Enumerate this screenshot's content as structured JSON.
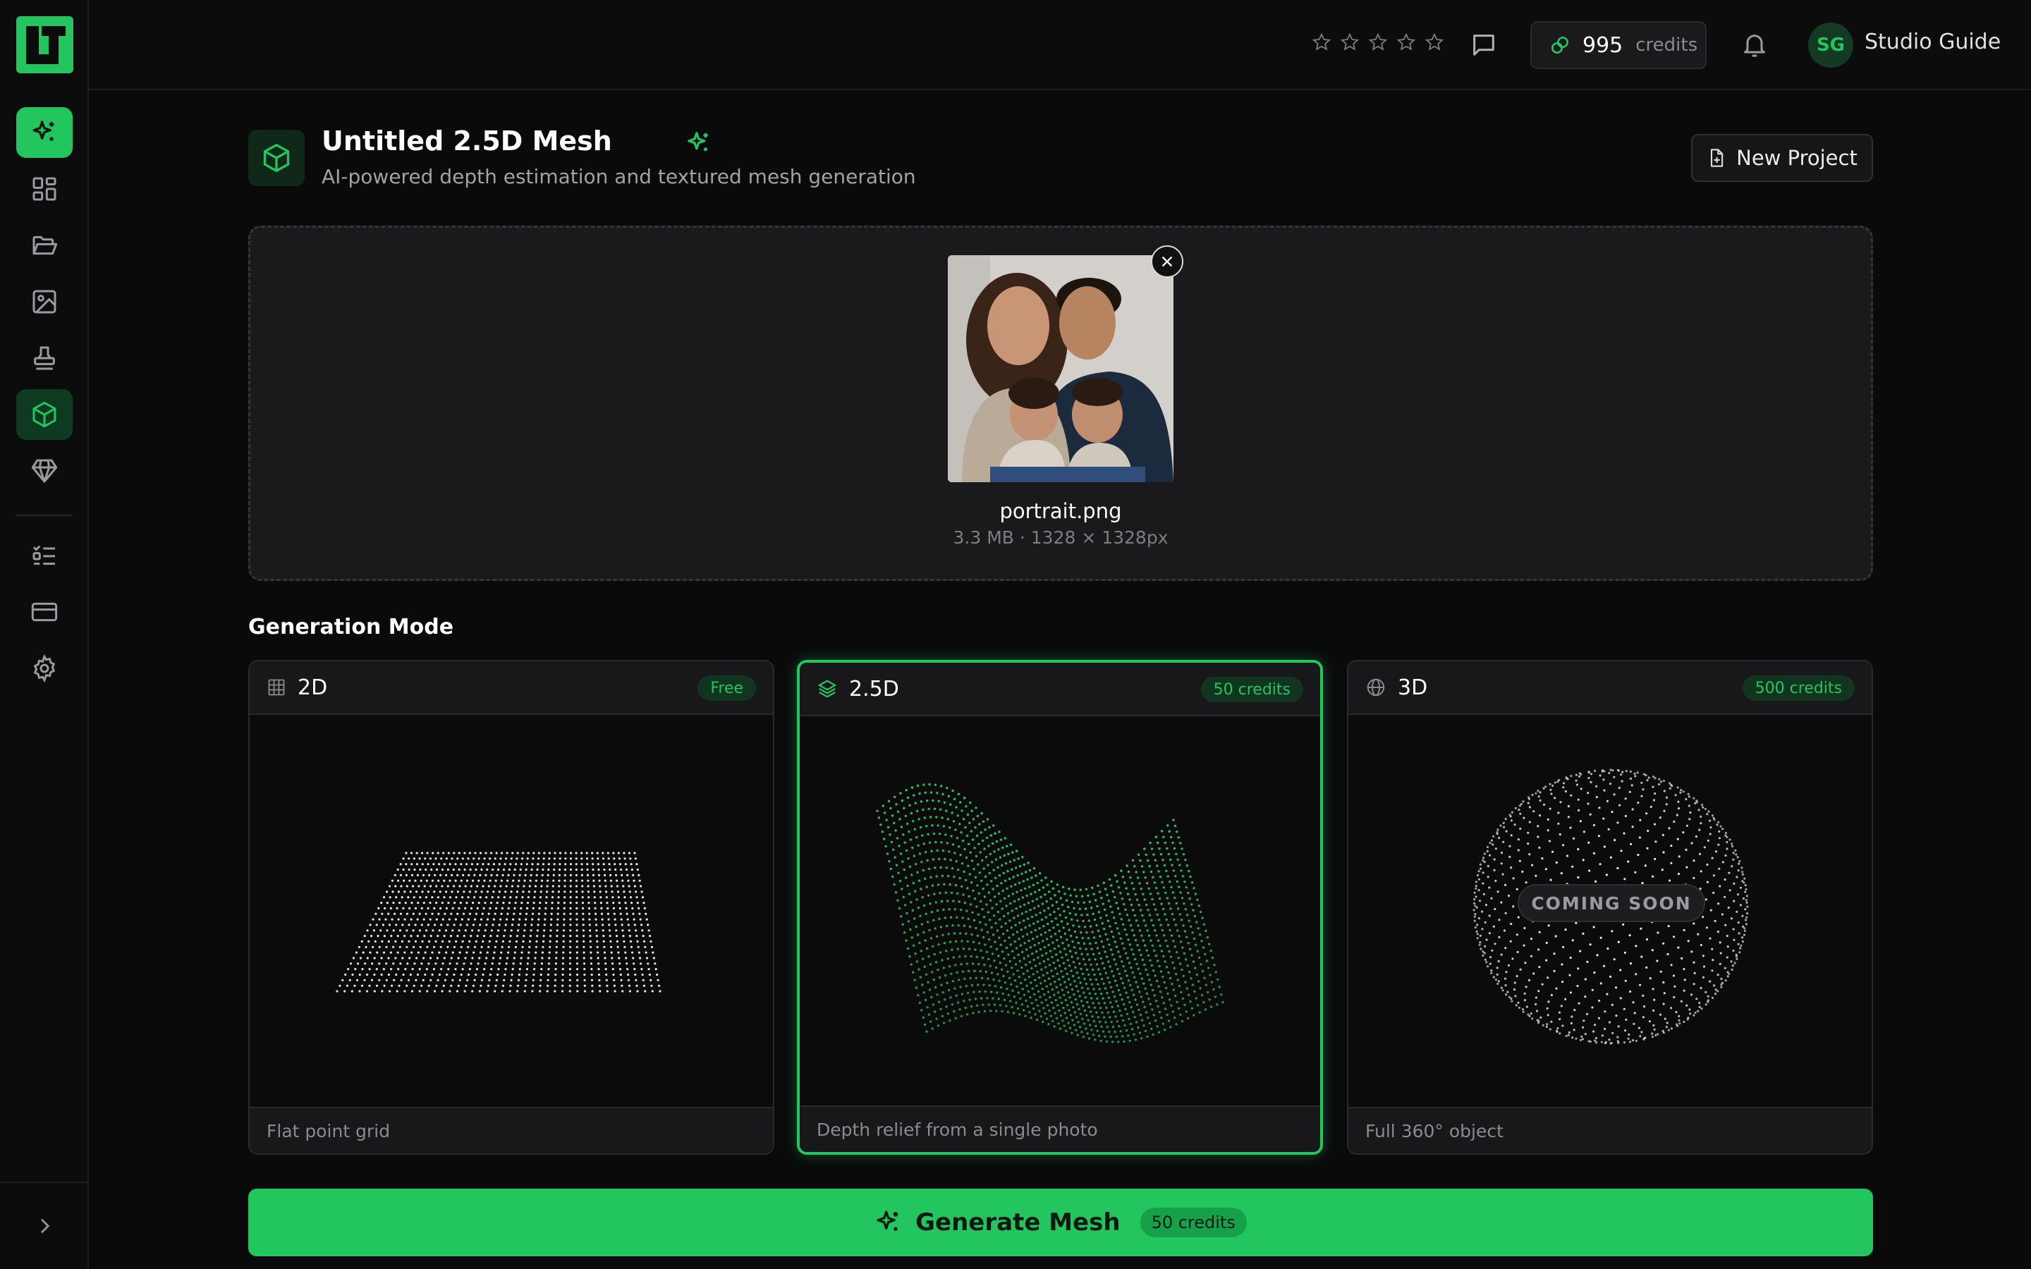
{
  "app": {
    "logo_text": "LT"
  },
  "sidebar": {
    "items": [
      {
        "name": "sparkle",
        "active": true
      },
      {
        "name": "dashboard"
      },
      {
        "name": "folder"
      },
      {
        "name": "image"
      },
      {
        "name": "stamp"
      },
      {
        "name": "mesh",
        "active_dark": true
      },
      {
        "name": "gem"
      },
      {
        "name": "tasks"
      },
      {
        "name": "billing"
      },
      {
        "name": "settings"
      }
    ]
  },
  "topbar": {
    "rating_stars": 5,
    "credits_value": "995",
    "credits_label": "credits",
    "user_initials": "SG",
    "user_name": "Studio Guide"
  },
  "header": {
    "title": "Untitled 2.5D Mesh",
    "subtitle": "AI-powered depth estimation and textured mesh generation",
    "new_project_label": "New Project"
  },
  "upload": {
    "file_name": "portrait.png",
    "file_meta": "3.3 MB · 1328 × 1328px"
  },
  "generation": {
    "section_title": "Generation Mode",
    "modes": [
      {
        "title": "2D",
        "badge": "Free",
        "caption": "Flat point grid"
      },
      {
        "title": "2.5D",
        "badge": "50 credits",
        "caption": "Depth relief from a single photo"
      },
      {
        "title": "3D",
        "badge": "500 credits",
        "caption": "Full 360° object",
        "overlay": "COMING SOON"
      }
    ]
  },
  "generate": {
    "label": "Generate Mesh",
    "cost": "50 credits"
  },
  "colors": {
    "accent": "#22c55e",
    "background": "#0a0a0b",
    "panel": "#1a1a1c"
  }
}
